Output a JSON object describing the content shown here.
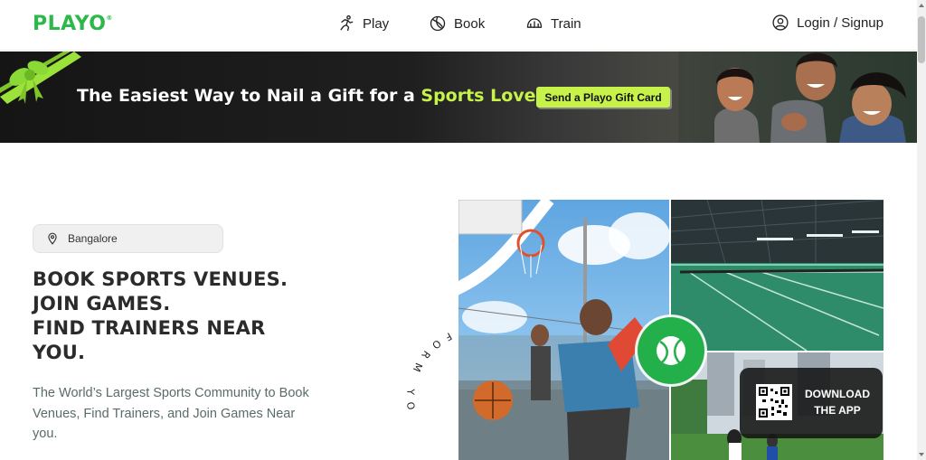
{
  "header": {
    "logo": "PLAYO",
    "logo_mark": "®",
    "nav": [
      {
        "label": "Play",
        "icon": "runner-icon"
      },
      {
        "label": "Book",
        "icon": "ball-icon"
      },
      {
        "label": "Train",
        "icon": "helmet-icon"
      }
    ],
    "login_label": "Login / Signup"
  },
  "banner": {
    "text_main": "The Easiest Way to Nail a Gift for a ",
    "text_highlight": "Sports Lover",
    "button_label": "Send a Playo Gift Card",
    "accent_color": "#c7f24a"
  },
  "hero": {
    "location": "Bangalore",
    "headline_lines": [
      "BOOK SPORTS VENUES.",
      "JOIN GAMES.",
      "FIND TRAINERS NEAR",
      "YOU."
    ],
    "subtext": "The World’s Largest Sports Community to Book Venues, Find Trainers, and Join Games Near you.",
    "circular_text": "PLATFORM YO",
    "download_line1": "DOWNLOAD",
    "download_line2": "THE APP"
  },
  "colors": {
    "brand": "#2db84b",
    "tennis_button": "#23b04a"
  }
}
